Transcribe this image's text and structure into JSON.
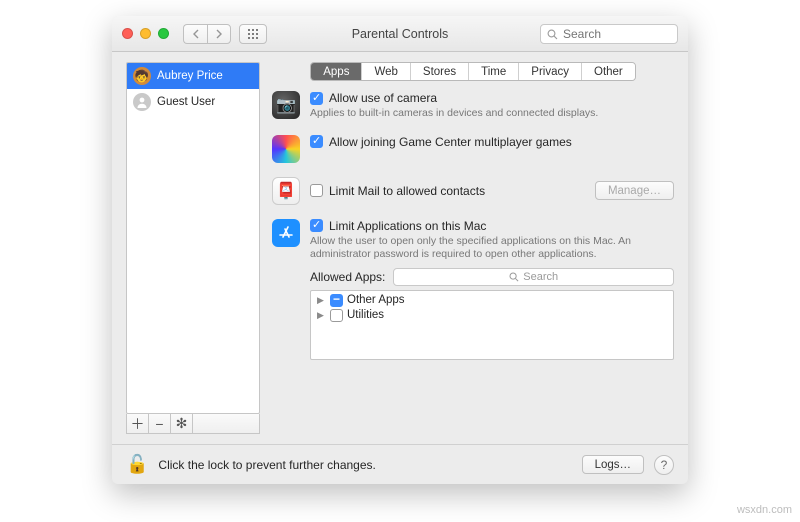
{
  "window": {
    "title": "Parental Controls"
  },
  "search": {
    "placeholder": "Search"
  },
  "sidebar": {
    "users": [
      {
        "name": "Aubrey Price",
        "selected": true
      },
      {
        "name": "Guest User",
        "selected": false
      }
    ]
  },
  "tabs": [
    "Apps",
    "Web",
    "Stores",
    "Time",
    "Privacy",
    "Other"
  ],
  "active_tab": 0,
  "settings": {
    "camera": {
      "label": "Allow use of camera",
      "checked": true,
      "desc": "Applies to built-in cameras in devices and connected displays."
    },
    "gamecenter": {
      "label": "Allow joining Game Center multiplayer games",
      "checked": true
    },
    "mail": {
      "label": "Limit Mail to allowed contacts",
      "checked": false,
      "manage_label": "Manage…"
    },
    "limitapps": {
      "label": "Limit Applications on this Mac",
      "checked": true,
      "desc": "Allow the user to open only the specified applications on this Mac. An administrator password is required to open other applications.",
      "allowed_label": "Allowed Apps:",
      "search_placeholder": "Search",
      "tree": [
        {
          "label": "Other Apps",
          "state": "mixed"
        },
        {
          "label": "Utilities",
          "state": "unchecked"
        }
      ]
    }
  },
  "footer": {
    "lock_text": "Click the lock to prevent further changes.",
    "logs_label": "Logs…"
  },
  "watermark": "wsxdn.com"
}
